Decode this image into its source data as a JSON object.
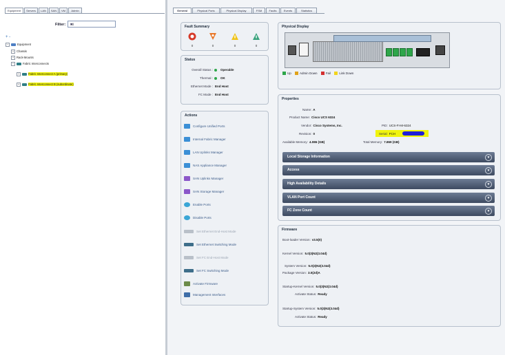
{
  "navigator": {
    "tabs": [
      "Equipment",
      "Servers",
      "LAN",
      "SAN",
      "VM",
      "Admin"
    ],
    "filter_label": "Filter:",
    "filter_value": "All",
    "tree_toolbar": "+ -",
    "tree": [
      {
        "label": "Equipment",
        "icon": "equipment-icon",
        "selected": false
      },
      {
        "label": "Chassis",
        "icon": "chassis-icon",
        "selected": false
      },
      {
        "label": "Rack-Mounts",
        "icon": "rack-icon",
        "selected": false
      },
      {
        "label": "Fabric Interconnects",
        "icon": "fabric-icon",
        "selected": false
      },
      {
        "label": "Fabric Interconnect A (primary)",
        "icon": "fi-icon",
        "selected": true
      },
      {
        "label": "Fabric Interconnect B (subordinate)",
        "icon": "fi-icon",
        "selected": true
      }
    ]
  },
  "main": {
    "tabs": [
      "General",
      "Physical Ports",
      "Physical Display",
      "FSM",
      "Faults",
      "Events",
      "Statistics"
    ],
    "fault_summary": {
      "title": "Fault Summary",
      "counts": [
        "0",
        "0",
        "0",
        "0"
      ],
      "colors": [
        "#d63a2a",
        "#e8782a",
        "#f0c419",
        "#3aa37d"
      ]
    },
    "status": {
      "title": "Status",
      "overall_status_label": "Overall Status :",
      "overall_status_value": "Operable",
      "thermal_label": "Thermal :",
      "thermal_value": "OK",
      "ethernet_mode_label": "Ethernet Mode :",
      "ethernet_mode_value": "End Host",
      "fc_mode_label": "FC Mode :",
      "fc_mode_value": "End Host"
    },
    "actions": {
      "title": "Actions",
      "items": [
        {
          "label": "Configure Unified Ports",
          "enabled": true,
          "color": "#3b8fd6"
        },
        {
          "label": "Internal Fabric Manager",
          "enabled": true,
          "color": "#3b8fd6"
        },
        {
          "label": "LAN Uplinks Manager",
          "enabled": true,
          "color": "#3b8fd6"
        },
        {
          "label": "NAS Appliance Manager",
          "enabled": true,
          "color": "#3b8fd6"
        },
        {
          "label": "SAN Uplinks Manager",
          "enabled": true,
          "color": "#8b57c9"
        },
        {
          "label": "SAN Storage Manager",
          "enabled": true,
          "color": "#8b57c9"
        },
        {
          "label": "Enable Ports",
          "enabled": true,
          "color": "#3aa6d6"
        },
        {
          "label": "Disable Ports",
          "enabled": true,
          "color": "#3aa6d6"
        },
        {
          "label": "Set Ethernet End-Host Mode",
          "enabled": false,
          "color": "#b9c0c9"
        },
        {
          "label": "Set Ethernet Switching Mode",
          "enabled": true,
          "color": "#3e6e8a"
        },
        {
          "label": "Set FC End-Host Mode",
          "enabled": false,
          "color": "#b9c0c9"
        },
        {
          "label": "Set FC Switching Mode",
          "enabled": true,
          "color": "#3e6e8a"
        },
        {
          "label": "Activate Firmware",
          "enabled": true,
          "color": "#6c8b4a"
        },
        {
          "label": "Management Interfaces",
          "enabled": true,
          "color": "#3f6ea8"
        }
      ]
    },
    "physical_display": {
      "title": "Physical Display",
      "legend": [
        {
          "label": "Up",
          "color": "#2ea64a"
        },
        {
          "label": "Admin Down",
          "color": "#e0a21a"
        },
        {
          "label": "Fail",
          "color": "#d32f2f"
        },
        {
          "label": "Link Down",
          "color": "#f2d41c"
        }
      ]
    },
    "properties": {
      "title": "Properties",
      "name_label": "Name:",
      "name_value": "A",
      "product_name_label": "Product Name:",
      "product_name_value": "Cisco UCS 6324",
      "vendor_label": "Vendor:",
      "vendor_value": "Cisco Systems, Inc.",
      "pid_label": "PID:",
      "pid_value": "UCS-FI-M-6324",
      "revision_label": "Revision:",
      "revision_value": "0",
      "serial_label": "Serial:",
      "serial_value": "FCH",
      "available_memory_label": "Available Memory:",
      "available_memory_value": "4.086 (GB)",
      "total_memory_label": "Total Memory:",
      "total_memory_value": "7.869 (GB)",
      "sections": [
        "Local Storage Information",
        "Access",
        "High Availability Details",
        "VLAN Port Count",
        "FC Zone Count"
      ]
    },
    "firmware": {
      "title": "Firmware",
      "boot_loader_label": "Boot-loader Version:",
      "boot_loader_value": "v3.5(0)",
      "kernel_label": "Kernel Version:",
      "kernel_value": "5.0(3)N2(3.04d)",
      "system_label": "System Version:",
      "system_value": "5.0(3)N2(3.04d)",
      "package_label": "Package Version:",
      "package_value": "3.0(2d)A",
      "startup_kernel_label": "Startup-Kernel Version:",
      "startup_kernel_value": "5.0(3)N2(3.04d)",
      "activate_status_label": "Activate Status:",
      "activate_status_value": "Ready",
      "startup_system_label": "Startup-System Version:",
      "startup_system_value": "5.0(3)N2(3.04d)",
      "activate_status2_label": "Activate Status:",
      "activate_status2_value": "Ready"
    }
  }
}
